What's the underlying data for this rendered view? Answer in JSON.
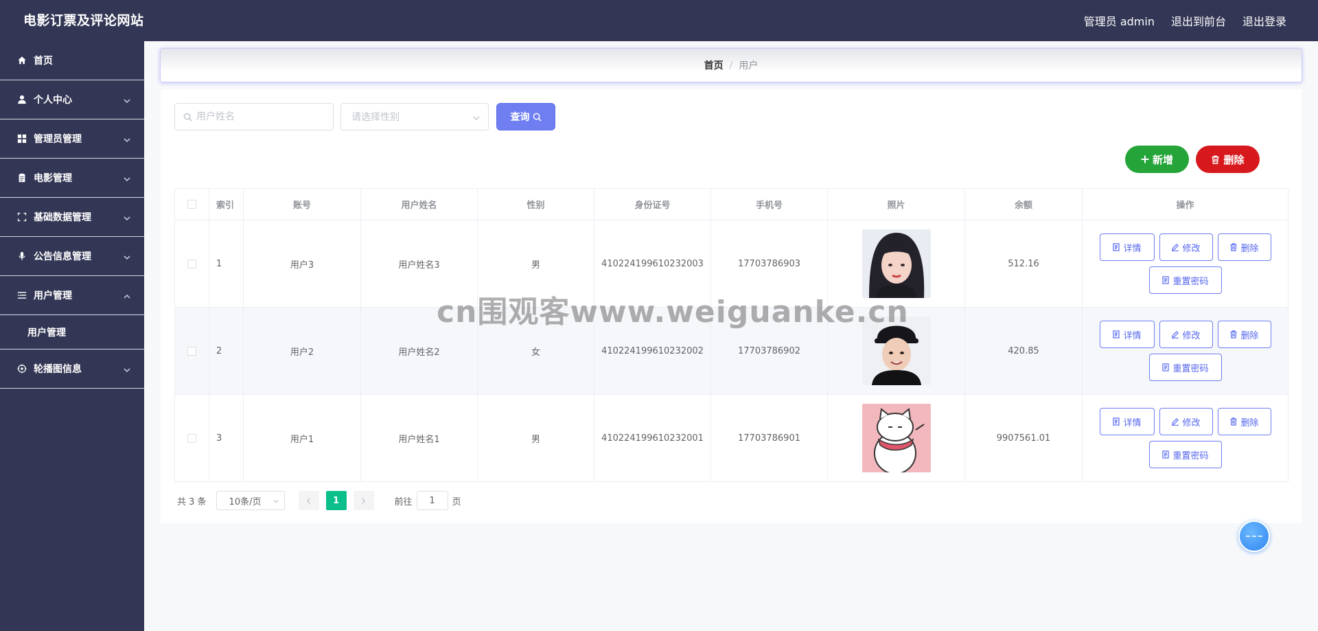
{
  "header": {
    "site_title": "电影订票及评论网站",
    "admin_label": "管理员 admin",
    "to_frontend": "退出到前台",
    "logout": "退出登录"
  },
  "sidebar": {
    "items": [
      {
        "label": "首页",
        "icon": "home-icon"
      },
      {
        "label": "个人中心",
        "icon": "user-icon"
      },
      {
        "label": "管理员管理",
        "icon": "grid-icon"
      },
      {
        "label": "电影管理",
        "icon": "clipboard-icon"
      },
      {
        "label": "基础数据管理",
        "icon": "frame-icon"
      },
      {
        "label": "公告信息管理",
        "icon": "microphone-icon"
      },
      {
        "label": "用户管理",
        "icon": "list-icon"
      },
      {
        "label": "轮播图信息",
        "icon": "target-icon"
      }
    ],
    "submenu": {
      "label": "用户管理"
    }
  },
  "breadcrumb": {
    "home": "首页",
    "separator": "/",
    "current": "用户"
  },
  "search": {
    "name_placeholder": "用户姓名",
    "gender_placeholder": "请选择性别",
    "query_label": "查询"
  },
  "actions": {
    "add_label": "新增",
    "delete_label": "删除"
  },
  "table": {
    "headers": [
      "索引",
      "账号",
      "用户姓名",
      "性别",
      "身份证号",
      "手机号",
      "照片",
      "余额",
      "操作"
    ],
    "rows": [
      {
        "index": "1",
        "account": "用户3",
        "name": "用户姓名3",
        "gender": "男",
        "id_card": "410224199610232003",
        "phone": "17703786903",
        "photo": "photo-girl",
        "balance": "512.16"
      },
      {
        "index": "2",
        "account": "用户2",
        "name": "用户姓名2",
        "gender": "女",
        "id_card": "410224199610232002",
        "phone": "17703786902",
        "photo": "photo-boy",
        "balance": "420.85"
      },
      {
        "index": "3",
        "account": "用户1",
        "name": "用户姓名1",
        "gender": "男",
        "id_card": "410224199610232001",
        "phone": "17703786901",
        "photo": "photo-cartoon-cat",
        "balance": "9907561.01"
      }
    ],
    "op_labels": {
      "detail": "详情",
      "edit": "修改",
      "delete": "删除",
      "reset_password": "重置密码"
    }
  },
  "pagination": {
    "total": "共 3 条",
    "page_size": "10条/页",
    "current_page": "1",
    "goto_label": "前往",
    "goto_value": "1",
    "page_unit": "页"
  },
  "watermark": "cn围观客www.weiguanke.cn",
  "colors": {
    "nav_bg": "#333755",
    "primary": "#6f7ff2",
    "add_green": "#25a43a",
    "delete_red": "#d7191d",
    "page_active": "#0bbf8a"
  }
}
